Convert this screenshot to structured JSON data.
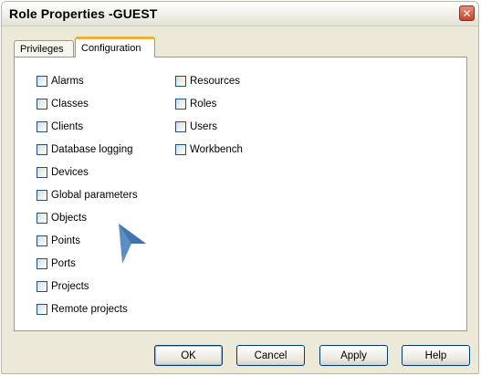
{
  "window": {
    "title": "Role Properties -GUEST",
    "close_symbol": "✕"
  },
  "tabs": [
    {
      "label": "Privileges",
      "selected": false
    },
    {
      "label": "Configuration",
      "selected": true
    }
  ],
  "checkboxes": {
    "column1": [
      {
        "label": "Alarms",
        "checked": false
      },
      {
        "label": "Classes",
        "checked": false
      },
      {
        "label": "Clients",
        "checked": false
      },
      {
        "label": "Database logging",
        "checked": false
      },
      {
        "label": "Devices",
        "checked": false
      },
      {
        "label": "Global parameters",
        "checked": false
      },
      {
        "label": "Objects",
        "checked": false
      },
      {
        "label": "Points",
        "checked": false
      },
      {
        "label": "Ports",
        "checked": false
      },
      {
        "label": "Projects",
        "checked": false
      },
      {
        "label": "Remote projects",
        "checked": false
      }
    ],
    "column2": [
      {
        "label": "Resources",
        "checked": false
      },
      {
        "label": "Roles",
        "checked": false
      },
      {
        "label": "Users",
        "checked": false
      },
      {
        "label": "Workbench",
        "checked": false
      }
    ]
  },
  "buttons": {
    "ok": "OK",
    "cancel": "Cancel",
    "apply": "Apply",
    "help": "Help"
  },
  "colors": {
    "accent_tab": "#f0b040",
    "cursor": "#5b8fc4",
    "close": "#c6452b"
  }
}
